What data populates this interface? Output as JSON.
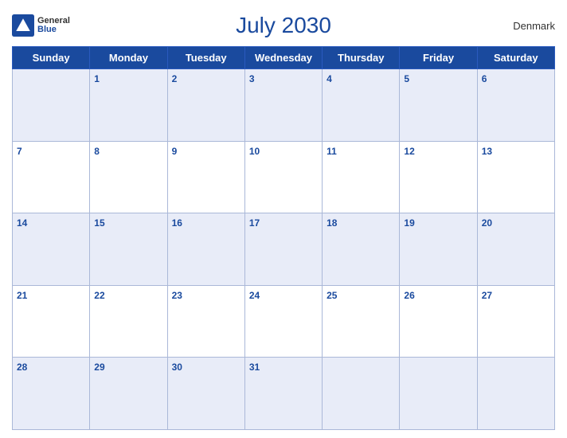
{
  "header": {
    "title": "July 2030",
    "country": "Denmark",
    "logo": {
      "general": "General",
      "blue": "Blue"
    }
  },
  "weekdays": [
    "Sunday",
    "Monday",
    "Tuesday",
    "Wednesday",
    "Thursday",
    "Friday",
    "Saturday"
  ],
  "weeks": [
    [
      null,
      1,
      2,
      3,
      4,
      5,
      6
    ],
    [
      7,
      8,
      9,
      10,
      11,
      12,
      13
    ],
    [
      14,
      15,
      16,
      17,
      18,
      19,
      20
    ],
    [
      21,
      22,
      23,
      24,
      25,
      26,
      27
    ],
    [
      28,
      29,
      30,
      31,
      null,
      null,
      null
    ]
  ]
}
